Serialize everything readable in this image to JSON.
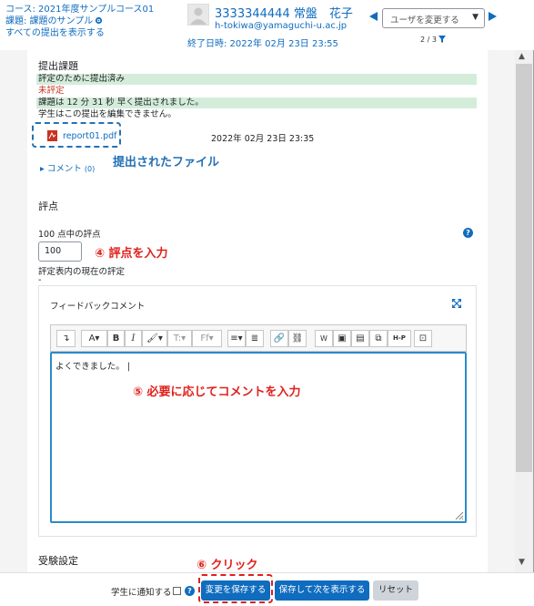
{
  "header": {
    "course": "コース: 2021年度サンプルコース01",
    "assignment": "課題: 課題のサンプル",
    "show_all": "すべての提出を表示する",
    "user_name": "3333344444 常盤　花子",
    "user_email": "h-tokiwa@yamaguchi-u.ac.jp",
    "due": "終了日時: 2022年 02月 23日 23:55",
    "user_select_placeholder": "ユーザを変更する",
    "pager": "2 / 3"
  },
  "submission": {
    "title": "提出課題",
    "status_graded": "評定のために提出済み",
    "status_grade": "未評定",
    "status_early": "課題は 12 分 31 秒 早く提出されました。",
    "status_edit": "学生はこの提出を編集できません。",
    "file_name": "report01.pdf",
    "file_date": "2022年 02月 23日 23:35",
    "comments_label": "コメント",
    "comments_count": "(0)"
  },
  "grade": {
    "title": "評点",
    "label": "100 点中の評点",
    "value": "100",
    "current_label": "評定表内の現在の評定",
    "current_value": "-"
  },
  "feedback": {
    "title": "フィードバックコメント",
    "editor_text": "よくできました。",
    "toolbar": [
      "↴",
      "A▾",
      "B",
      "I",
      "🖌▾",
      "T:▾",
      "Ff▾",
      "≡▾",
      "≣",
      "🔗",
      "⛓",
      "W",
      "▣",
      "▤",
      "⧉",
      "H-P",
      "⊡"
    ]
  },
  "next_section": "受験設定",
  "annotations": {
    "file": "提出されたファイル",
    "step4": "④ 評点を入力",
    "step5": "⑤ 必要に応じてコメントを入力",
    "step6": "⑥ クリック"
  },
  "footer": {
    "notify_label": "学生に通知する",
    "save": "変更を保存する",
    "save_next": "保存して次を表示する",
    "reset": "リセット"
  },
  "colors": {
    "link": "#0f6cbf",
    "success_bg": "#d4edda",
    "annotation_red": "#e0201b",
    "annotation_blue": "#2471b5"
  }
}
